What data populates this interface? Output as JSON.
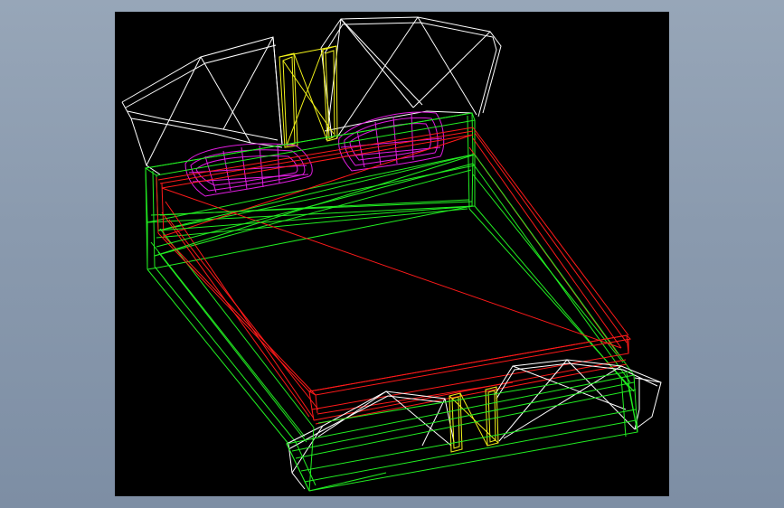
{
  "viewport": {
    "background": "#000000",
    "line_colors": {
      "headboard": "#ffffff",
      "frame": "#22ee22",
      "rails": "#ff1a1a",
      "posts": "#f2f21a",
      "pillows": "#e01de0"
    }
  }
}
